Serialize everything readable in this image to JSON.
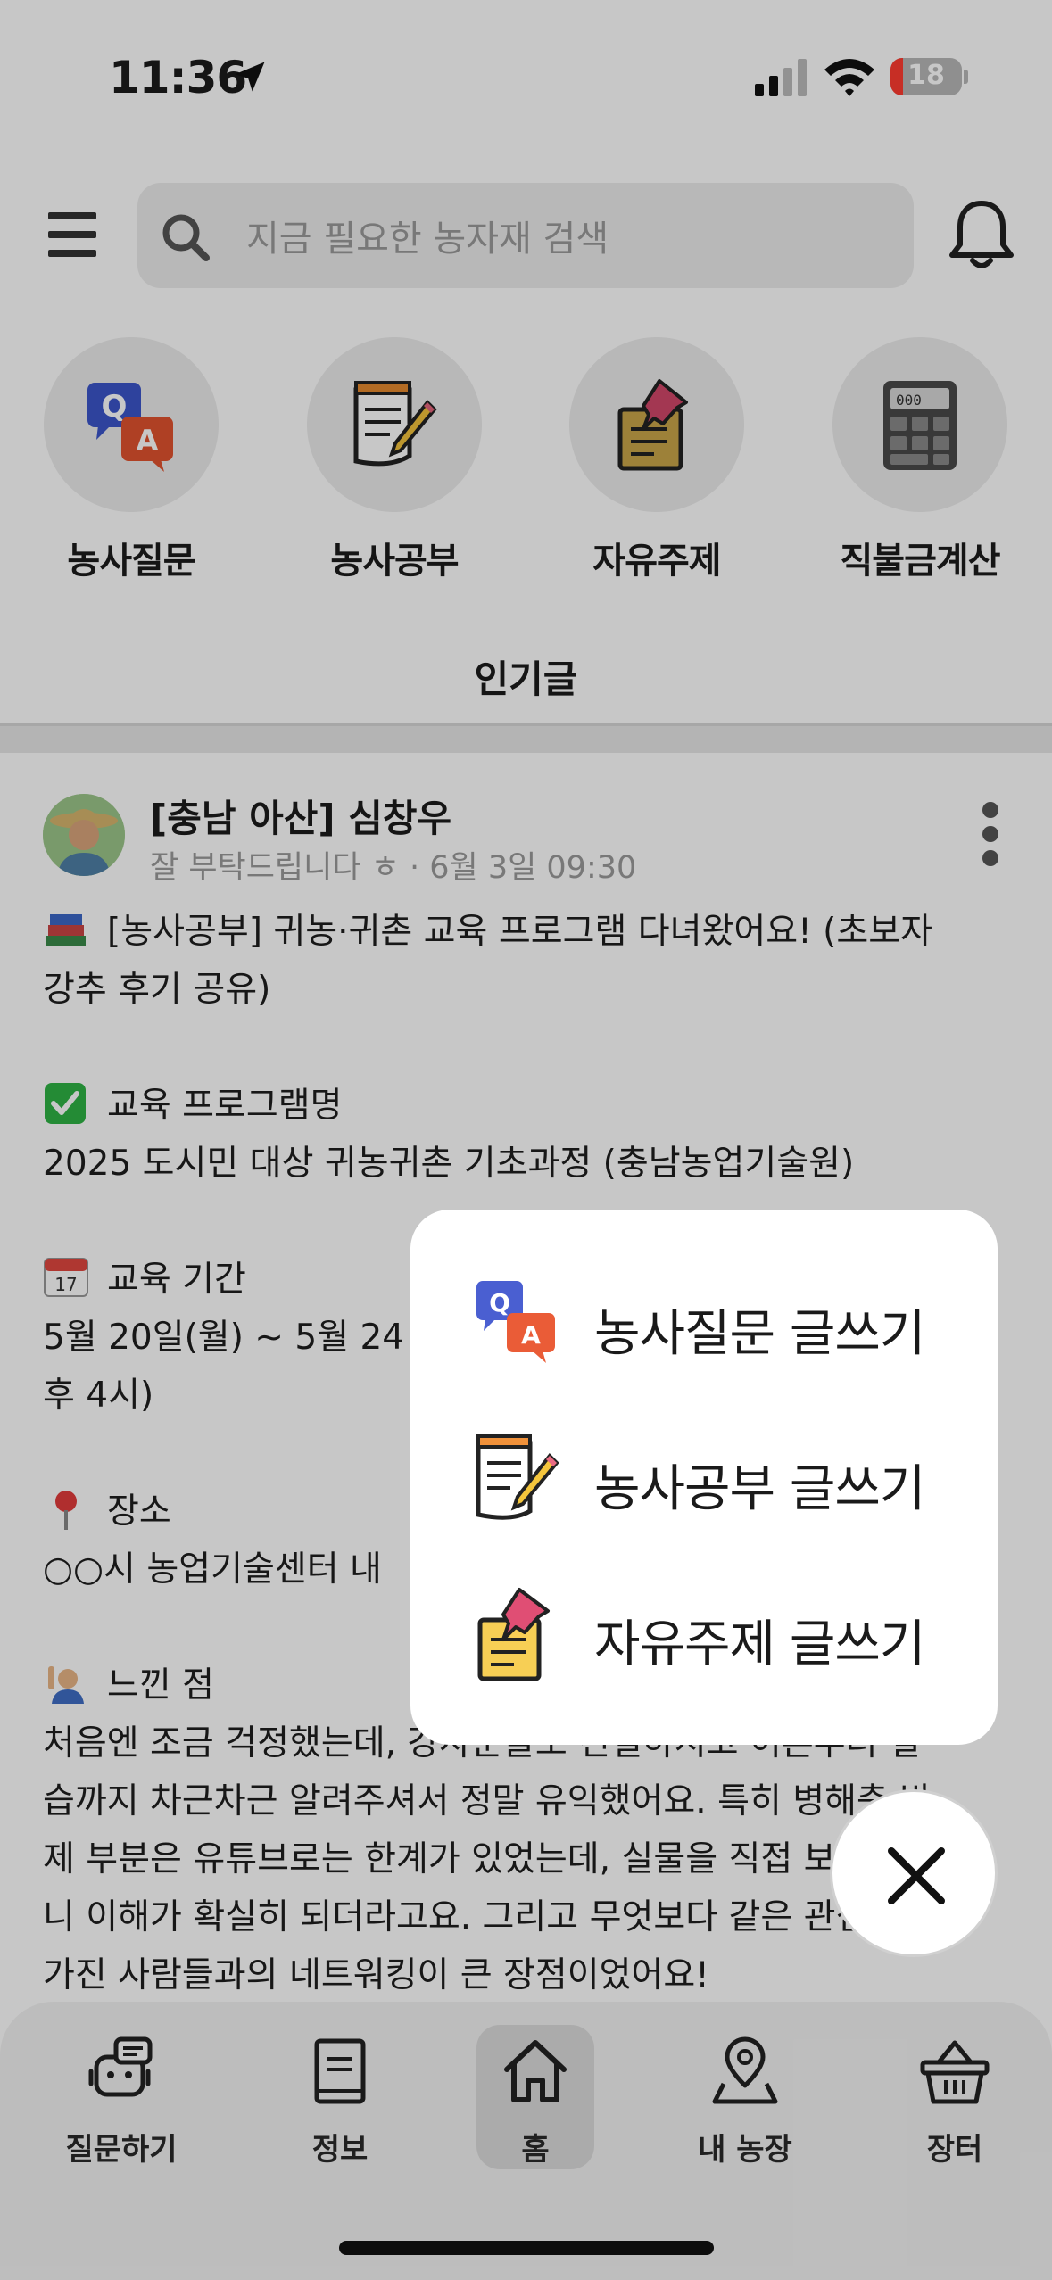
{
  "status_bar": {
    "time": "11:36",
    "battery_level": "18",
    "battery_fraction": 0.18
  },
  "header": {
    "search_placeholder": "지금 필요한 농자재 검색"
  },
  "categories": [
    {
      "label": "농사질문",
      "icon": "qa-bubbles-icon"
    },
    {
      "label": "농사공부",
      "icon": "notepad-pencil-icon"
    },
    {
      "label": "자유주제",
      "icon": "pushpin-note-icon"
    },
    {
      "label": "직불금계산",
      "icon": "calculator-icon"
    }
  ],
  "popular": {
    "title": "인기글"
  },
  "post": {
    "author": "[충남 아산] 심창우",
    "meta": "잘 부탁드립니다 ㅎ · 6월 3일 09:30",
    "lines": [
      "[농사공부] 귀농·귀촌 교육 프로그램 다녀왔어요! (초보자",
      "강추 후기 공유)",
      "교육 프로그램명",
      "2025 도시민 대상 귀농귀촌 기초과정 (충남농업기술원)",
      "교육 기간",
      "5월 20일(월) ~ 5월 24",
      "후 4시)",
      "장소",
      "○○시 농업기술센터 내",
      "느낀 점",
      "처음엔 조금 걱정했는데, 강사분들도 친절하시고 이론부터 실",
      "습까지 차근차근 알려주셔서 정말 유익했어요. 특히 병해충 방",
      "제 부분은 유튜브로는 한계가 있었는데, 실물을 직접 보면서 하",
      "니 이해가 확실히 되더라고요. 그리고 무엇보다 같은 관심사를",
      "가진 사람들과의 네트워킹이 큰 장점이었어요!"
    ]
  },
  "write_menu": {
    "items": [
      {
        "label": "농사질문 글쓰기",
        "icon": "qa-bubbles-icon"
      },
      {
        "label": "농사공부 글쓰기",
        "icon": "notepad-pencil-icon"
      },
      {
        "label": "자유주제 글쓰기",
        "icon": "pushpin-note-icon"
      }
    ]
  },
  "bottom_nav": {
    "items": [
      {
        "label": "질문하기",
        "icon": "robot-chat-icon"
      },
      {
        "label": "정보",
        "icon": "book-icon"
      },
      {
        "label": "홈",
        "icon": "home-icon",
        "active": true
      },
      {
        "label": "내 농장",
        "icon": "map-pin-icon"
      },
      {
        "label": "장터",
        "icon": "basket-icon"
      }
    ]
  },
  "colors": {
    "accent_red": "#ff3b30",
    "overlay": "rgba(0,0,0,0.22)"
  }
}
